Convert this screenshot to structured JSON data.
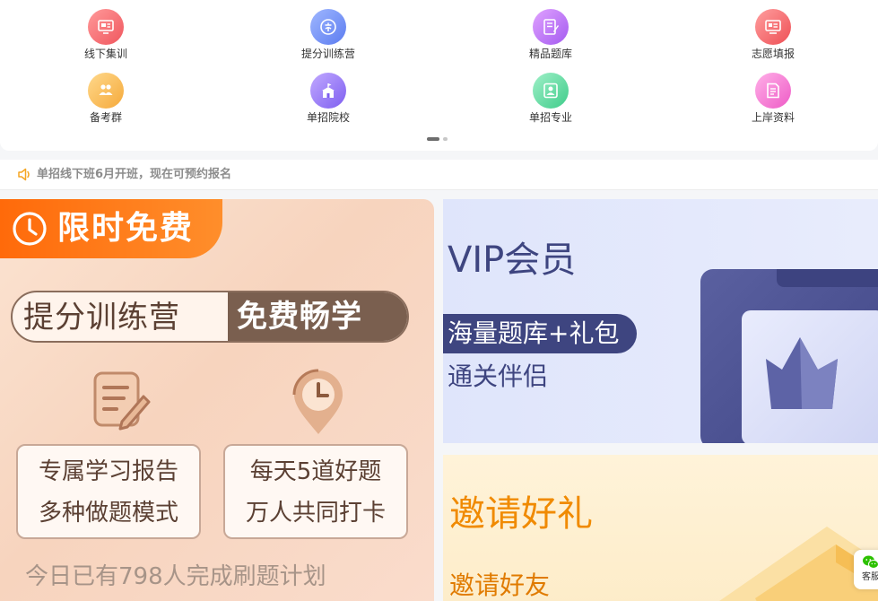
{
  "nav_grid": {
    "items": [
      {
        "label": "线下集训",
        "icon": "classroom-icon",
        "color_from": "#ff9a9a",
        "color_to": "#f0565e"
      },
      {
        "label": "提分训练营",
        "icon": "free-badge-icon",
        "color_from": "#9fb7ff",
        "color_to": "#5c7cf0"
      },
      {
        "label": "精品题库",
        "icon": "notebook-icon",
        "color_from": "#e0a2ff",
        "color_to": "#a45bf0"
      },
      {
        "label": "志愿填报",
        "icon": "form-icon",
        "color_from": "#ff9f9f",
        "color_to": "#ee4f55"
      },
      {
        "label": "备考群",
        "icon": "group-icon",
        "color_from": "#ffd98c",
        "color_to": "#f5a93a"
      },
      {
        "label": "单招院校",
        "icon": "school-icon",
        "color_from": "#c1a9ff",
        "color_to": "#7e5ff0"
      },
      {
        "label": "单招专业",
        "icon": "major-icon",
        "color_from": "#9ff0c8",
        "color_to": "#3fcc8a"
      },
      {
        "label": "上岸资料",
        "icon": "document-icon",
        "color_from": "#ffb0e8",
        "color_to": "#ee5bc6"
      }
    ]
  },
  "notice": {
    "text": "单招线下班6月开班，现在可预约报名",
    "icon": "speaker-icon",
    "icon_color": "#f5a623"
  },
  "promo_banner": {
    "tag": "限时免费",
    "pill_left": "提分训练营",
    "pill_right": "免费畅学",
    "card_left": [
      "专属学习报告",
      "多种做题模式"
    ],
    "card_right": [
      "每天5道好题",
      "万人共同打卡"
    ],
    "footer": "今日已有798人完成刷题计划",
    "accent": "#ff6a0a"
  },
  "vip_banner": {
    "title": "VIP会员",
    "pill": "海量题库+礼包",
    "subtitle": "通关伴侣",
    "accent": "#3e4580"
  },
  "invite_banner": {
    "title": "邀请好礼",
    "subtitle": "邀请好友",
    "accent": "#f08a00"
  },
  "service": {
    "label": "客服",
    "icon": "wechat-icon"
  }
}
